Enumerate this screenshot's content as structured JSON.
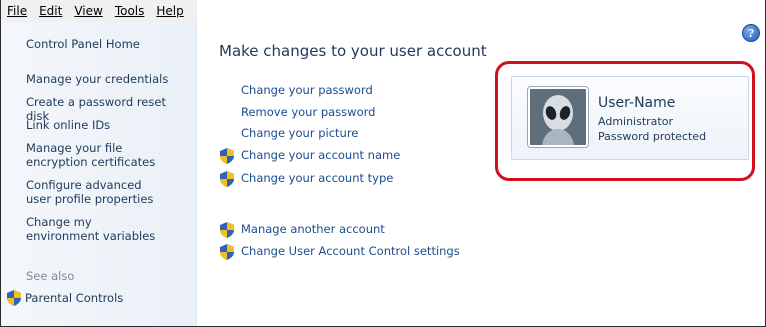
{
  "menu": {
    "file": "File",
    "edit": "Edit",
    "view": "View",
    "tools": "Tools",
    "help": "Help"
  },
  "sidebar": {
    "home": "Control Panel Home",
    "tasks": [
      "Manage your credentials",
      "Create a password reset disk",
      "Link online IDs",
      "Manage your file encryption certificates",
      "Configure advanced user profile properties",
      "Change my environment variables"
    ],
    "see_also": "See also",
    "parental_controls": "Parental Controls"
  },
  "main": {
    "title": "Make changes to your user account",
    "links": [
      "Change your password",
      "Remove your password",
      "Change your picture",
      "Change your account name",
      "Change your account type"
    ],
    "admin_links": [
      "Manage another account",
      "Change User Account Control settings"
    ]
  },
  "account": {
    "name": "User-Name",
    "role": "Administrator",
    "status": "Password protected"
  },
  "help_glyph": "?",
  "colors": {
    "highlight_border": "#d0101d",
    "link": "#1e4b8f",
    "sidebar_text": "#1e395b"
  }
}
